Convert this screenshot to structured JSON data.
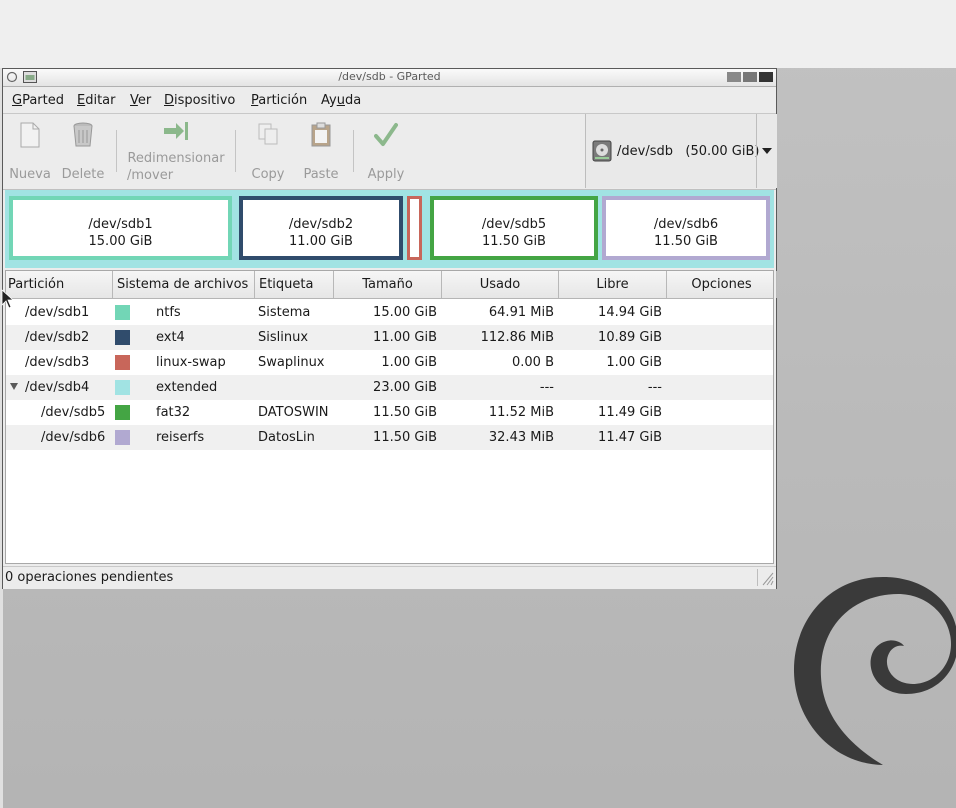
{
  "window": {
    "title": "/dev/sdb - GParted"
  },
  "menu": [
    {
      "label": "GParted",
      "u": "G",
      "rest": "Parted"
    },
    {
      "label": "Editar",
      "u": "E",
      "rest": "ditar"
    },
    {
      "label": "Ver",
      "u": "V",
      "rest": "er"
    },
    {
      "label": "Dispositivo",
      "u": "D",
      "rest": "ispositivo"
    },
    {
      "label": "Partición",
      "u": "P",
      "rest": "artición"
    },
    {
      "label": "Ayuda",
      "pre": "Ay",
      "u": "u",
      "post": "da"
    }
  ],
  "toolbar": {
    "new": "Nueva",
    "delete": "Delete",
    "resize_line1": "Redimensionar",
    "resize_line2": "/mover",
    "copy": "Copy",
    "paste": "Paste",
    "apply": "Apply"
  },
  "device": {
    "label": "/dev/sdb   (50.00 GiB)"
  },
  "map": [
    {
      "name": "/dev/sdb1",
      "size": "15.00 GiB",
      "color": "#72d6b6"
    },
    {
      "name": "/dev/sdb2",
      "size": "11.00 GiB",
      "color": "#304c6c"
    },
    {
      "name": "/dev/sdb5",
      "size": "11.50 GiB",
      "color": "#44a544"
    },
    {
      "name": "/dev/sdb6",
      "size": "11.50 GiB",
      "color": "#b1a9d1"
    }
  ],
  "swap_color": "#c8665a",
  "extended_color": "#a1e3e3",
  "columns": [
    "Partición",
    "Sistema de archivos",
    "Etiqueta",
    "Tamaño",
    "Usado",
    "Libre",
    "Opciones"
  ],
  "rows": [
    {
      "partition": "/dev/sdb1",
      "fs": "ntfs",
      "label": "Sistema",
      "size": "15.00 GiB",
      "used": "64.91 MiB",
      "free": "14.94 GiB",
      "color": "#72d6b6"
    },
    {
      "partition": "/dev/sdb2",
      "fs": "ext4",
      "label": "Sislinux",
      "size": "11.00 GiB",
      "used": "112.86 MiB",
      "free": "10.89 GiB",
      "color": "#304c6c"
    },
    {
      "partition": "/dev/sdb3",
      "fs": "linux-swap",
      "label": "Swaplinux",
      "size": "1.00 GiB",
      "used": "0.00 B",
      "free": "1.00 GiB",
      "color": "#c8665a"
    },
    {
      "partition": "/dev/sdb4",
      "fs": "extended",
      "label": "",
      "size": "23.00 GiB",
      "used": "---",
      "free": "---",
      "color": "#a1e3e3"
    },
    {
      "partition": "/dev/sdb5",
      "fs": "fat32",
      "label": "DATOSWIN",
      "size": "11.50 GiB",
      "used": "11.52 MiB",
      "free": "11.49 GiB",
      "color": "#44a544"
    },
    {
      "partition": "/dev/sdb6",
      "fs": "reiserfs",
      "label": "DatosLin",
      "size": "11.50 GiB",
      "used": "32.43 MiB",
      "free": "11.47 GiB",
      "color": "#b1a9d1"
    }
  ],
  "status": {
    "text": "0 operaciones pendientes"
  }
}
